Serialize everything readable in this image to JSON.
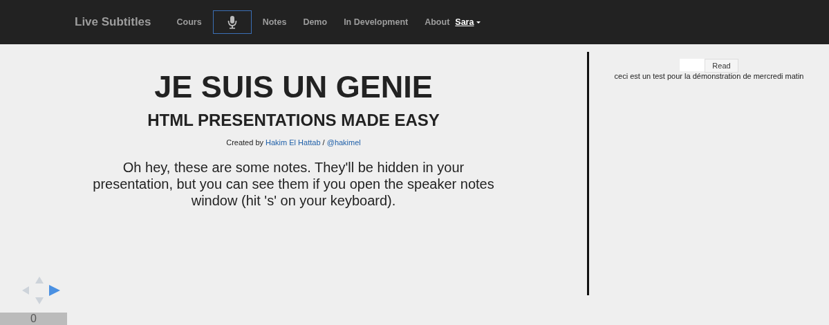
{
  "navbar": {
    "brand": "Live Subtitles",
    "items": [
      {
        "kind": "text",
        "label": "Cours",
        "selected": false
      },
      {
        "kind": "mic",
        "selected": true
      },
      {
        "kind": "text",
        "label": "Notes",
        "selected": false
      },
      {
        "kind": "text",
        "label": "Demo",
        "selected": false
      },
      {
        "kind": "text",
        "label": "In Development",
        "selected": false
      },
      {
        "kind": "text",
        "label": "About",
        "selected": false
      }
    ],
    "user": {
      "label": "Sara"
    }
  },
  "slide": {
    "title": "JE SUIS UN GENIE",
    "subtitle": "HTML PRESENTATIONS MADE EASY",
    "credit": [
      {
        "kind": "text",
        "text": "Created by "
      },
      {
        "kind": "link",
        "text": "Hakim El Hattab"
      },
      {
        "kind": "text",
        "text": " / "
      },
      {
        "kind": "link",
        "text": "@hakimel"
      }
    ],
    "notes": "Oh hey, these are some notes. They'll be hidden in your presentation, but you can see them if you open the speaker notes window (hit 's' on your keyboard).",
    "controls": [
      {
        "kind": "up",
        "enabled": false
      },
      {
        "kind": "left",
        "enabled": false
      },
      {
        "kind": "right",
        "enabled": true
      },
      {
        "kind": "down",
        "enabled": false
      }
    ],
    "slide_number": "0"
  },
  "subtitles": {
    "button": "Read",
    "text": "ceci est un test pour la démonstration de mercredi matin"
  }
}
